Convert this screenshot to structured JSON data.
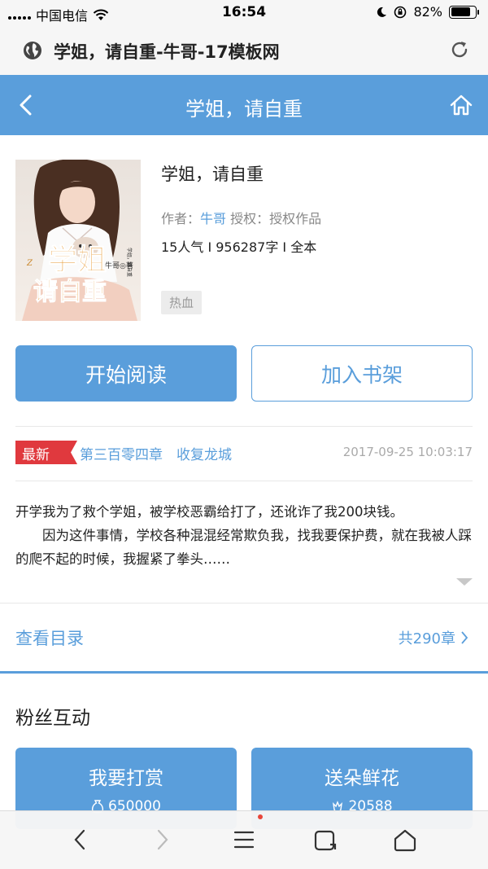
{
  "status_bar": {
    "carrier": "中国电信",
    "time": "16:54",
    "battery": "82%",
    "battery_level": 0.82
  },
  "browser": {
    "page_title": "学姐，请自重-牛哥-17模板网"
  },
  "header": {
    "title": "学姐，请自重"
  },
  "book": {
    "title": "学姐，请自重",
    "author_label": "作者：",
    "author": "牛哥",
    "license_label": " 授权：",
    "license": "授权作品",
    "stats": "15人气 I 956287字 I 全本",
    "tag": "热血",
    "cover": {
      "title_line1": "学姐",
      "title_line2": "请自重",
      "author_mark": "牛哥◎著",
      "side_text": "学姐，请自重",
      "logo_text": "Z"
    }
  },
  "actions": {
    "read_label": "开始阅读",
    "shelf_label": "加入书架"
  },
  "latest": {
    "badge": "最新",
    "chapter": "第三百零四章　收复龙城",
    "date": "2017-09-25 10:03:17"
  },
  "intro": {
    "line1": "开学我为了救个学姐，被学校恶霸给打了，还讹诈了我200块钱。",
    "line2": "因为这件事情，学校各种混混经常欺负我，找我要保护费，就在我被人踩的爬不起的时候，我握紧了拳头……"
  },
  "catalog": {
    "label": "查看目录",
    "count": "共290章"
  },
  "fans": {
    "title": "粉丝互动",
    "reward_label": "我要打赏",
    "reward_count": "650000",
    "flower_label": "送朵鲜花",
    "flower_count": "20588"
  },
  "colors": {
    "primary": "#5a9edb",
    "badge_red": "#e0393e"
  }
}
